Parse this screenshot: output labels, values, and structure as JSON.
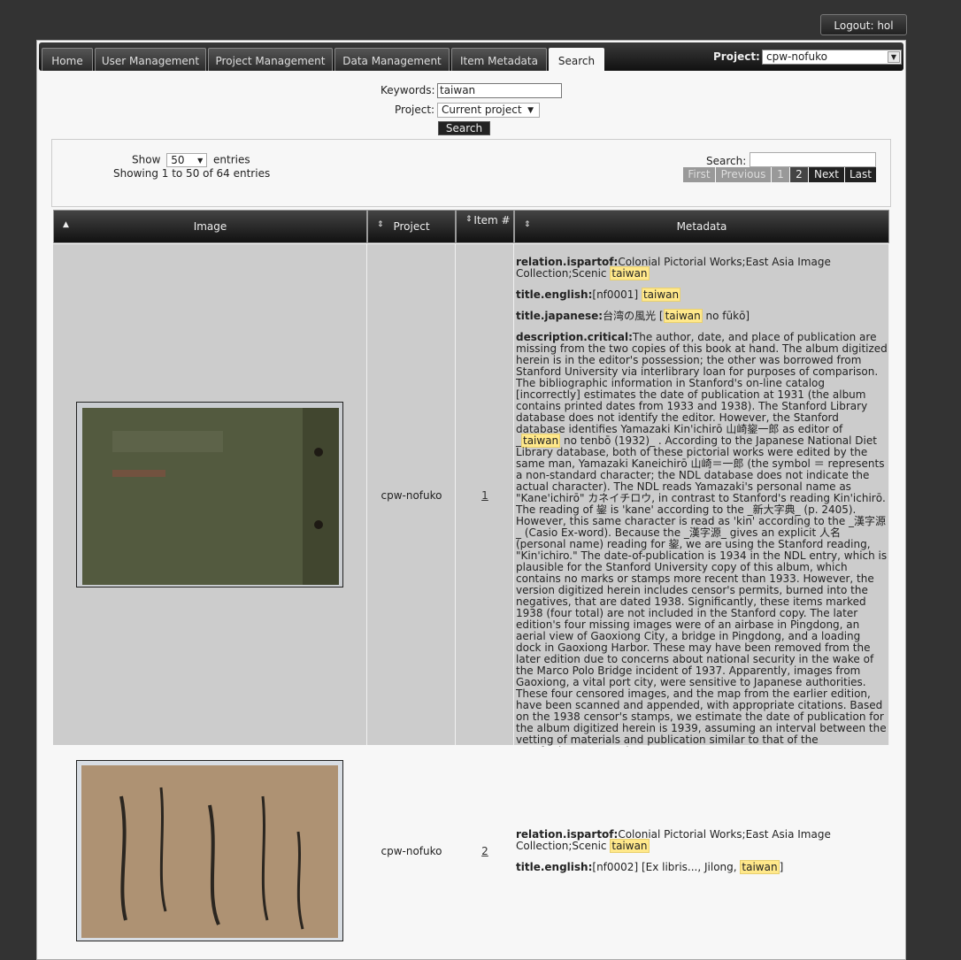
{
  "header": {
    "logout_label": "Logout: hol"
  },
  "nav": {
    "tabs": [
      "Home",
      "User Management",
      "Project Management",
      "Data Management",
      "Item Metadata",
      "Search"
    ],
    "project_label": "Project:",
    "project_value": "cpw-nofuko"
  },
  "search_form": {
    "keywords_label": "Keywords:",
    "keywords_value": "taiwan",
    "project_label": "Project:",
    "project_value": "Current project",
    "search_button": "Search"
  },
  "table_controls": {
    "show_label": "Show",
    "entries_value": "50",
    "entries_label": "entries",
    "info": "Showing 1 to 50 of 64 entries",
    "search_label": "Search:",
    "pager": [
      "First",
      "Previous",
      "1",
      "2",
      "Next",
      "Last"
    ]
  },
  "columns": [
    "Image",
    "Project",
    "Item #",
    "Metadata"
  ],
  "rows": [
    {
      "project": "cpw-nofuko",
      "item": "1",
      "relation_key": "relation.ispartof:",
      "relation_text": "Colonial Pictorial Works;East Asia Image Collection;Scenic ",
      "title_en_key": "title.english:",
      "title_en_text": "[nf0001] ",
      "title_ja_key": "title.japanese:",
      "title_ja_text": "台湾の風光 [",
      "title_ja_after": " no fūkō]",
      "desc_key": "description.critical:",
      "desc_before": "The author, date, and place of publication are missing from the two copies of this book at hand. The album digitized herein is in the editor's possession; the other was borrowed from Stanford University via interlibrary loan for purposes of comparison. The bibliographic information in Stanford's on-line catalog [incorrectly] estimates the date of publication at 1931 (the album contains printed dates from 1933 and 1938). The Stanford Library database does not identify the editor. However, the Stanford database identifies Yamazaki Kin'ichirō 山崎鋆一郎 as editor of _",
      "desc_after": " no tenbō (1932)_ . According to the Japanese National Diet Library database, both of these pictorial works were edited by the same man, Yamazaki Kaneichirō 山崎＝一郎 (the symbol ＝ represents a non-standard character; the NDL database does not indicate the actual character). The NDL reads Yamazaki's personal name as \"Kane'ichirō\" カネイチロウ, in contrast to Stanford's reading Kin'ichirō. The reading of 鋆 is 'kane' according to the _新大字典_ (p. 2405). However, this same character is read as 'kin' according to the _漢字源_ (Casio Ex-word). Because the _漢字源_ gives an explicit 人名 (personal name) reading for 鋆, we are using the Stanford reading, \"Kin'ichiro.\" The date-of-publication is 1934 in the NDL entry, which is plausible for the Stanford University copy of this album, which contains no marks or stamps more recent than 1933. However, the version digitized herein includes censor's permits, burned into the negatives, that are dated 1938. Significantly, these items marked 1938 (four total) are not included in the Stanford copy. The later edition's four missing images were of an airbase in Pingdong, an aerial view of Gaoxiong City, a bridge in Pingdong, and a loading dock in Gaoxiong Harbor. These may have been removed from the later edition due to concerns about national security in the wake of the Marco Polo Bridge incident of 1937. Apparently, images from Gaoxiong, a vital port city, were sensitive to Japanese authorities. These four censored images, and the map from the earlier edition, have been scanned and appended, with appropriate citations. Based on the 1938 censor's stamps, we estimate the date of publication for the album digitized herein is 1939, assuming an interval between the vetting of materials and publication similar to that of the Stanford/Hoover Institute copy.",
      "highlight": "taiwan"
    },
    {
      "project": "cpw-nofuko",
      "item": "2",
      "relation_key": "relation.ispartof:",
      "relation_text": "Colonial Pictorial Works;East Asia Image Collection;Scenic ",
      "title_en_key": "title.english:",
      "title_en_text": "[nf0002] [Ex libris..., Jilong, ",
      "title_en_after": "]",
      "highlight": "taiwan"
    }
  ],
  "colors": {
    "background": "#333333",
    "page": "#f7f7f7",
    "row_shade": "#cccccc",
    "highlight": "#ffe88a"
  }
}
